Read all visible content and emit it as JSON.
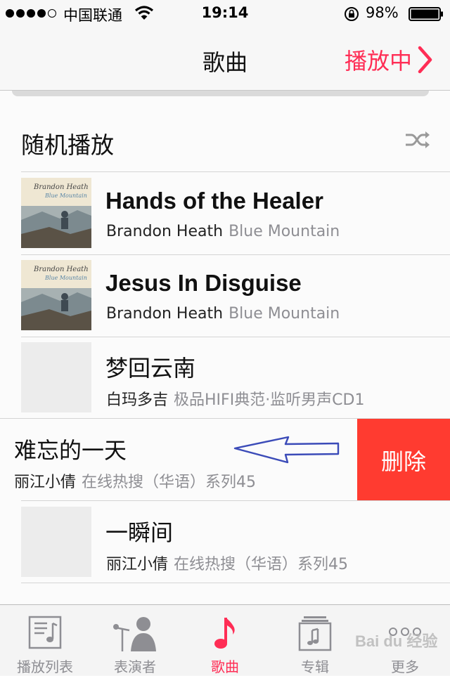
{
  "status_bar": {
    "carrier": "中国联通",
    "time": "19:14",
    "battery": "98%"
  },
  "nav": {
    "title": "歌曲",
    "now_playing": "播放中"
  },
  "shuffle": {
    "label": "随机播放",
    "icon": "shuffle-icon"
  },
  "songs": [
    {
      "title": "Hands of the Healer",
      "artist": "Brandon Heath",
      "album": "Blue Mountain"
    },
    {
      "title": "Jesus In Disguise",
      "artist": "Brandon Heath",
      "album": "Blue Mountain"
    },
    {
      "title": "梦回云南",
      "artist": "白玛多吉",
      "album": "极品HIFI典范·监听男声CD1"
    },
    {
      "title": "难忘的一天",
      "artist": "丽江小倩",
      "album": "在线热搜（华语）系列45",
      "action": "删除"
    },
    {
      "title": "一瞬间",
      "artist": "丽江小倩",
      "album": "在线热搜（华语）系列45"
    }
  ],
  "tabs": [
    {
      "label": "播放列表",
      "icon": "playlist-icon"
    },
    {
      "label": "表演者",
      "icon": "artist-icon"
    },
    {
      "label": "歌曲",
      "icon": "music-note-icon",
      "active": true
    },
    {
      "label": "专辑",
      "icon": "album-icon"
    },
    {
      "label": "更多",
      "icon": "more-icon"
    }
  ],
  "colors": {
    "accent": "#ff2d55",
    "delete": "#ff3b30",
    "secondary_text": "#8e8e93"
  },
  "watermark": "Bai du 经验"
}
